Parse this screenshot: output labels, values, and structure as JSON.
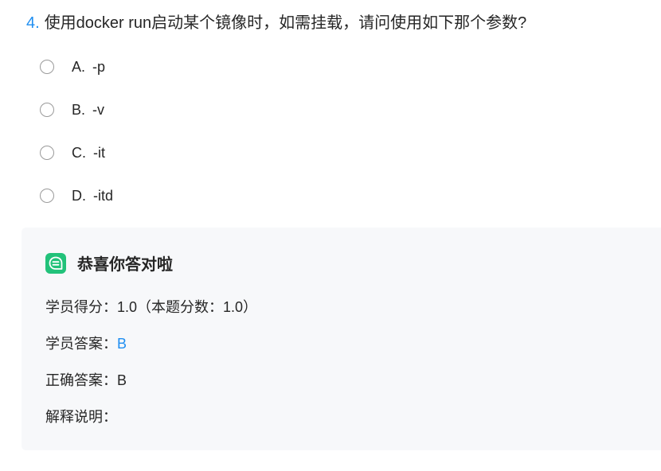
{
  "question": {
    "number": "4.",
    "text": "使用docker run启动某个镜像时，如需挂载，请问使用如下那个参数?"
  },
  "options": [
    {
      "letter": "A.",
      "text": "-p"
    },
    {
      "letter": "B.",
      "text": "-v"
    },
    {
      "letter": "C.",
      "text": "-it"
    },
    {
      "letter": "D.",
      "text": "-itd"
    }
  ],
  "result": {
    "title": "恭喜你答对啦",
    "icon": "chat-bubble-icon",
    "score_label": "学员得分：",
    "score_value": "1.0（本题分数：1.0）",
    "student_answer_label": "学员答案：",
    "student_answer_value": "B",
    "correct_answer_label": "正确答案：",
    "correct_answer_value": "B",
    "explanation_label": "解释说明：",
    "explanation_value": ""
  },
  "colors": {
    "accent": "#1f8ef1",
    "icon_green": "#22c27a",
    "panel_bg": "#f7f8fa",
    "text": "#262626"
  }
}
